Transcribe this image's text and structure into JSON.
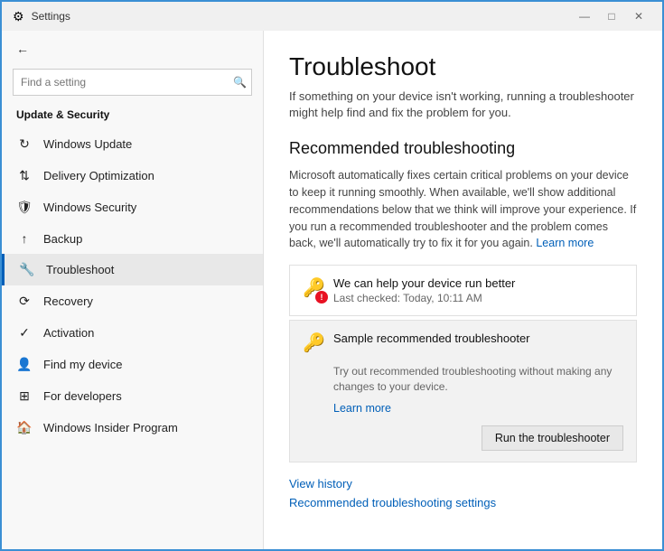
{
  "titleBar": {
    "title": "Settings",
    "minimizeLabel": "—",
    "maximizeLabel": "□",
    "closeLabel": "✕"
  },
  "sidebar": {
    "backArrow": "←",
    "appTitle": "Settings",
    "searchPlaceholder": "Find a setting",
    "sectionTitle": "Update & Security",
    "items": [
      {
        "id": "windows-update",
        "label": "Windows Update",
        "icon": "↻"
      },
      {
        "id": "delivery-optimization",
        "label": "Delivery Optimization",
        "icon": "⇅"
      },
      {
        "id": "windows-security",
        "label": "Windows Security",
        "icon": "🛡"
      },
      {
        "id": "backup",
        "label": "Backup",
        "icon": "↑"
      },
      {
        "id": "troubleshoot",
        "label": "Troubleshoot",
        "icon": "🔧",
        "active": true
      },
      {
        "id": "recovery",
        "label": "Recovery",
        "icon": "⟳"
      },
      {
        "id": "activation",
        "label": "Activation",
        "icon": "✓"
      },
      {
        "id": "find-my-device",
        "label": "Find my device",
        "icon": "👤"
      },
      {
        "id": "for-developers",
        "label": "For developers",
        "icon": "⊞"
      },
      {
        "id": "windows-insider",
        "label": "Windows Insider Program",
        "icon": "🏠"
      }
    ]
  },
  "main": {
    "pageTitle": "Troubleshoot",
    "pageDescription": "If something on your device isn't working, running a troubleshooter might help find and fix the problem for you.",
    "sectionTitle": "Recommended troubleshooting",
    "sectionDescription": "Microsoft automatically fixes certain critical problems on your device to keep it running smoothly. When available, we'll show additional recommendations below that we think will improve your experience. If you run a recommended troubleshooter and the problem comes back, we'll automatically try to fix it for you again.",
    "learnMoreLabel": "Learn more",
    "cards": [
      {
        "id": "card-1",
        "title": "We can help your device run better",
        "subtitle": "Last checked: Today, 10:11 AM",
        "hasWarning": true,
        "warningLabel": "!"
      },
      {
        "id": "card-2",
        "title": "Sample recommended troubleshooter",
        "subtitle": "",
        "description": "Try out recommended troubleshooting without making any changes to your device.",
        "learnMoreLabel": "Learn more",
        "runButtonLabel": "Run the troubleshooter",
        "hasWarning": false,
        "highlighted": true
      }
    ],
    "viewHistoryLabel": "View history",
    "settingsLabel": "Recommended troubleshooting settings"
  }
}
